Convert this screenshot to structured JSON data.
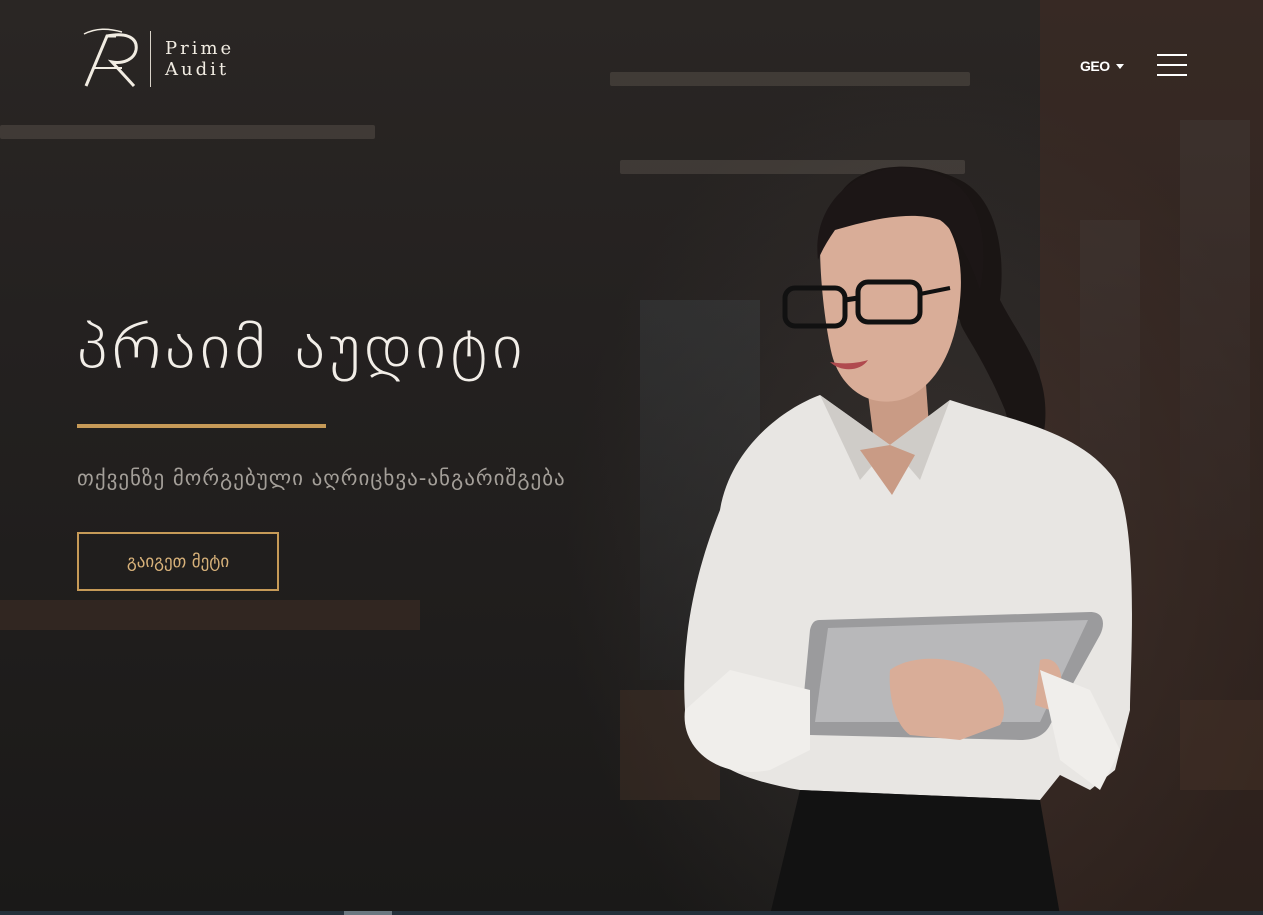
{
  "brand": {
    "name_line1": "Prime",
    "name_line2": "Audit",
    "monogram": "AR"
  },
  "header": {
    "language": "GEO",
    "menu_icon": "hamburger-icon"
  },
  "hero": {
    "title": "პრაიმ აუდიტი",
    "subtitle": "თქვენზე მორგებული აღრიცხვა-ანგარიშგება",
    "cta_label": "გაიგეთ მეტი"
  },
  "colors": {
    "accent": "#c69a57",
    "background": "#221f1e",
    "text_primary": "#f2eee8",
    "text_secondary": "#a49f99"
  }
}
